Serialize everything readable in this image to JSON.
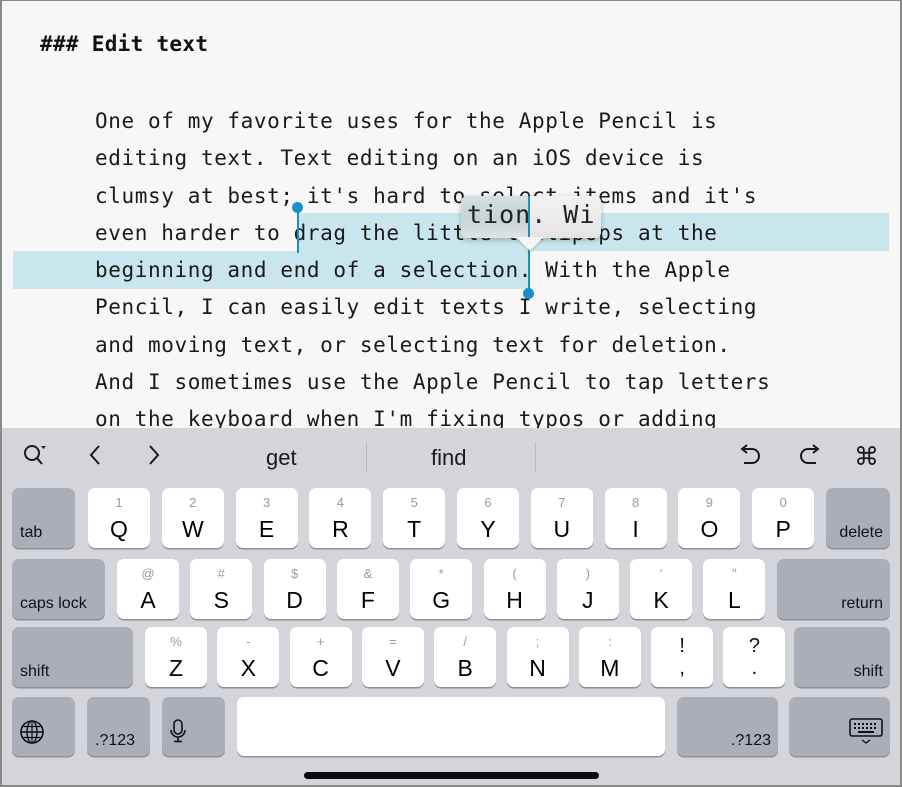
{
  "editor": {
    "heading": "### Edit text",
    "lines": [
      "One of my favorite uses for the Apple Pencil is",
      "editing text. Text editing on an iOS device is",
      "clumsy at best; it's hard to select items and it's",
      "even harder to drag the little lollipops at the",
      "beginning and end of a selection. With the Apple",
      "Pencil, I can easily edit texts I write, selecting",
      "and moving text, or selecting text for deletion.",
      "And I sometimes use the Apple Pencil to tap letters",
      "on the keyboard when I'm fixing typos or adding"
    ],
    "line4_before": "even harder to ",
    "line4_selected": "drag the little lollipops at the",
    "line5_selected": "beginning and end of a selection",
    "line5_after": ". With the Apple",
    "magnifier_text": "tion. Wi",
    "selection_color": "#c9e6ee",
    "cursor_color": "#1b8fc9"
  },
  "shortcut_bar": {
    "search_icon": "search-options-icon",
    "back_icon": "chevron-left-icon",
    "forward_icon": "chevron-right-icon",
    "suggestions": [
      "get",
      "find"
    ],
    "undo_icon": "undo-icon",
    "redo_icon": "redo-icon",
    "command_icon": "command-icon"
  },
  "keyboard": {
    "row1": [
      {
        "main": "Q",
        "alt": "1"
      },
      {
        "main": "W",
        "alt": "2"
      },
      {
        "main": "E",
        "alt": "3"
      },
      {
        "main": "R",
        "alt": "4"
      },
      {
        "main": "T",
        "alt": "5"
      },
      {
        "main": "Y",
        "alt": "6"
      },
      {
        "main": "U",
        "alt": "7"
      },
      {
        "main": "I",
        "alt": "8"
      },
      {
        "main": "O",
        "alt": "9"
      },
      {
        "main": "P",
        "alt": "0"
      }
    ],
    "row2": [
      {
        "main": "A",
        "alt": "@"
      },
      {
        "main": "S",
        "alt": "#"
      },
      {
        "main": "D",
        "alt": "$"
      },
      {
        "main": "F",
        "alt": "&"
      },
      {
        "main": "G",
        "alt": "*"
      },
      {
        "main": "H",
        "alt": "("
      },
      {
        "main": "J",
        "alt": ")"
      },
      {
        "main": "K",
        "alt": "'"
      },
      {
        "main": "L",
        "alt": "\""
      }
    ],
    "row3": [
      {
        "main": "Z",
        "alt": "%"
      },
      {
        "main": "X",
        "alt": "-"
      },
      {
        "main": "C",
        "alt": "+"
      },
      {
        "main": "V",
        "alt": "="
      },
      {
        "main": "B",
        "alt": "/"
      },
      {
        "main": "N",
        "alt": ";"
      },
      {
        "main": "M",
        "alt": ":"
      },
      {
        "main": ",",
        "alt": "!"
      },
      {
        "main": ".",
        "alt": "?"
      }
    ],
    "tab": "tab",
    "delete": "delete",
    "caps_lock": "caps lock",
    "return": "return",
    "shift_left": "shift",
    "shift_right": "shift",
    "numbers_left": ".?123",
    "numbers_right": ".?123",
    "globe_icon": "globe-icon",
    "mic_icon": "microphone-icon",
    "dismiss_icon": "keyboard-dismiss-icon",
    "space": ""
  }
}
